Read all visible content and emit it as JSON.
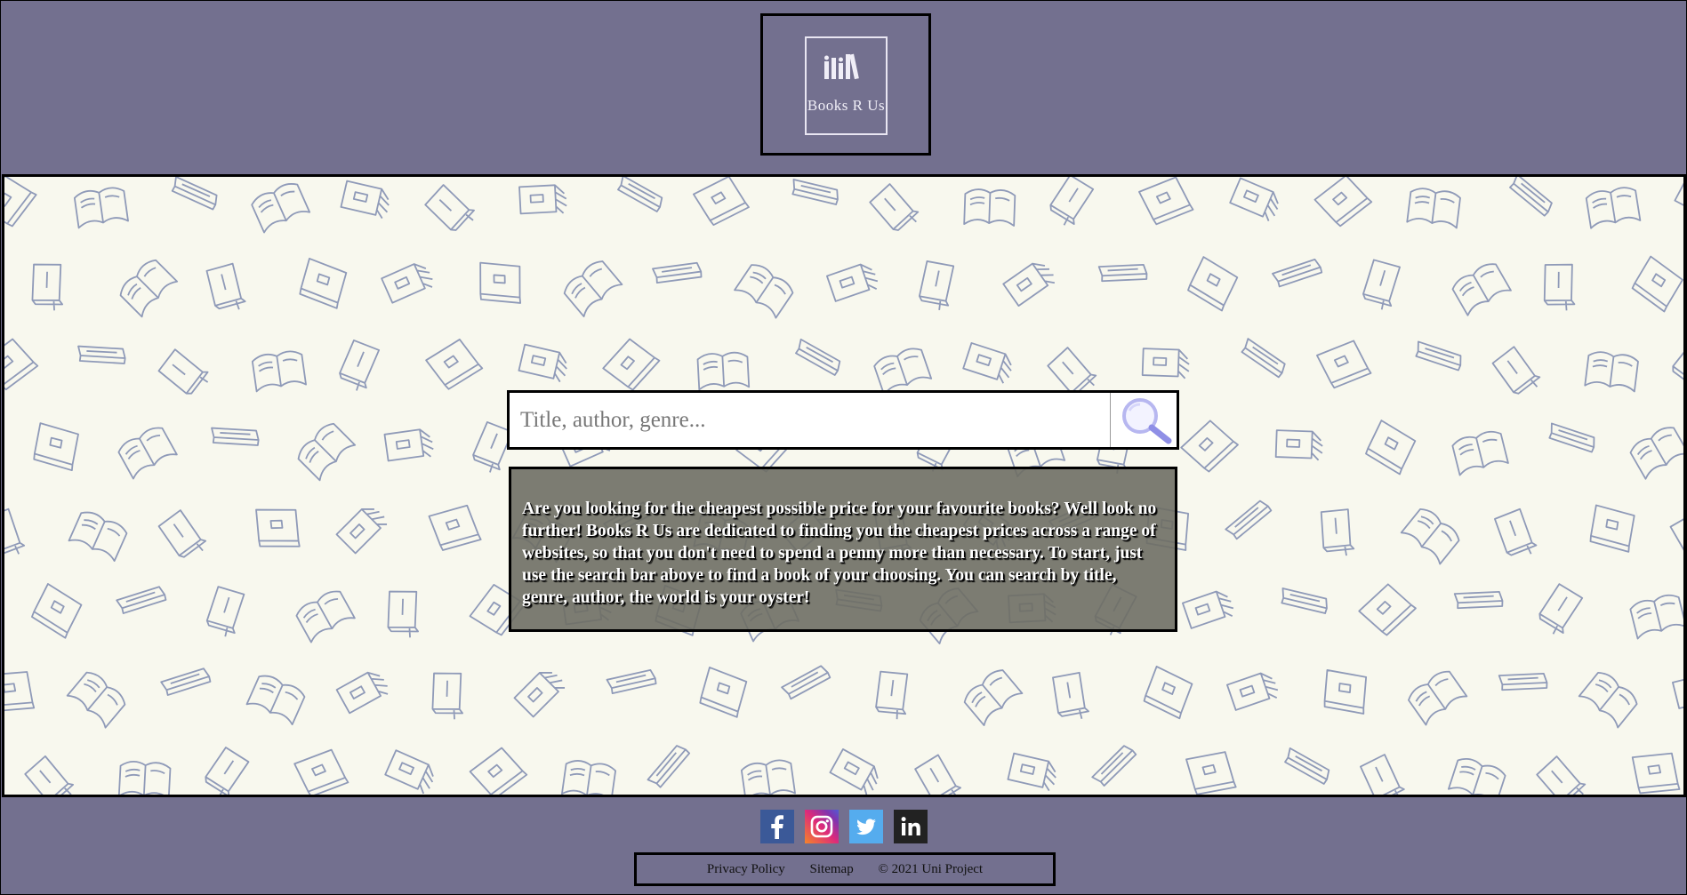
{
  "header": {
    "logo_text": "Books R Us"
  },
  "search": {
    "placeholder": "Title, author, genre..."
  },
  "intro": {
    "text": "Are you looking for the cheapest possible price for your favourite books? Well look no further! Books R Us are dedicated to finding you the cheapest prices across a range of websites, so that you don't need to spend a penny more than necessary. To start, just use the search bar above to find a book of your choosing. You can search by title, genre, author, the world is your oyster!"
  },
  "footer": {
    "social": [
      {
        "icon": "facebook-icon",
        "color": "#3b5998"
      },
      {
        "icon": "instagram-icon",
        "color": "#dd2a7b"
      },
      {
        "icon": "twitter-icon",
        "color": "#55acee"
      },
      {
        "icon": "linkedin-icon",
        "color": "#222222"
      }
    ],
    "privacy_label": "Privacy Policy",
    "sitemap_label": "Sitemap",
    "copyright": "© 2021 Uni Project"
  },
  "colors": {
    "header_bg": "#73708f",
    "hero_bg": "#f8f8ee",
    "pattern_stroke": "#8f9ab8",
    "intro_bg": "#6e6e64"
  }
}
